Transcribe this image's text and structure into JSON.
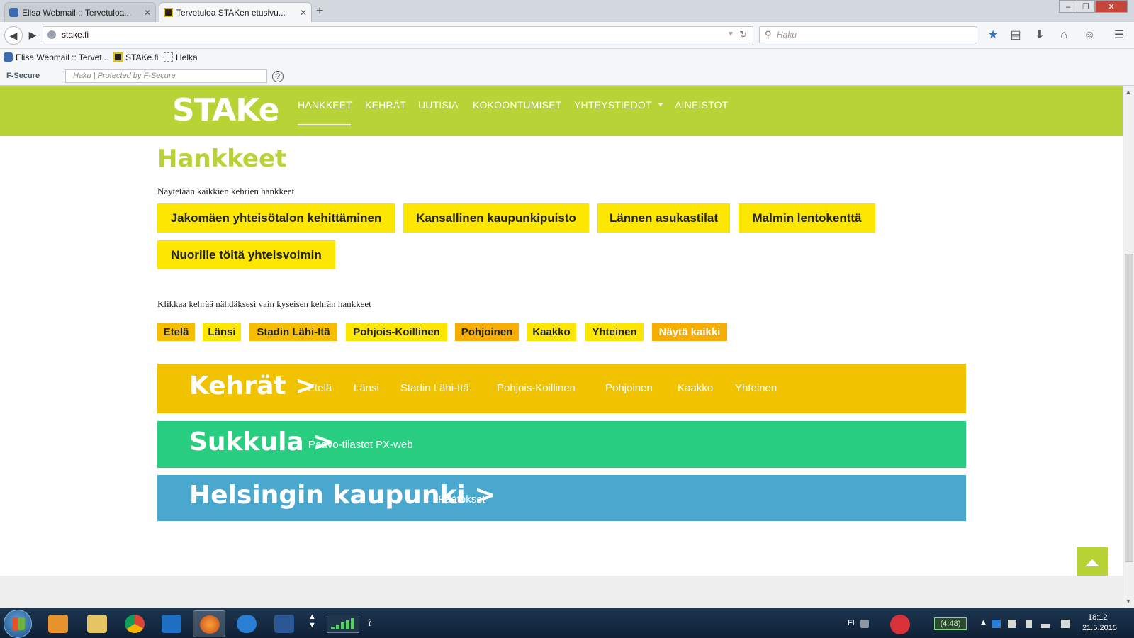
{
  "browser": {
    "tabs": [
      {
        "label": "Elisa Webmail :: Tervetuloa...",
        "active": false
      },
      {
        "label": "Tervetuloa STAKen etusivu...",
        "active": true
      }
    ],
    "new_tab": "+",
    "url": "stake.fi",
    "search_placeholder": "Haku",
    "bookmarks": [
      "Elisa Webmail :: Tervet...",
      "STAKe.fi",
      "Helka"
    ],
    "fsecure": {
      "logo": "F-Secure",
      "placeholder": "Haku | Protected by F-Secure",
      "help": "?"
    }
  },
  "site": {
    "logo": "STAKe",
    "menu": [
      "HANKKEET",
      "KEHRÄT",
      "UUTISIA",
      "KOKOONTUMISET",
      "YHTEYSTIEDOT",
      "AINEISTOT"
    ],
    "page_title": "Hankkeet",
    "showing_note": "Näytetään kaikkien kehrien hankkeet",
    "projects": [
      "Jakomäen yhteisötalon kehittäminen",
      "Kansallinen kaupunkipuisto",
      "Lännen asukastilat",
      "Malmin lentokenttä",
      "Nuorille töitä yhteisvoimin"
    ],
    "filter_note": "Klikkaa kehrää nähdäksesi vain kyseisen kehrän hankkeet",
    "filters": [
      "Etelä",
      "Länsi",
      "Stadin Lähi-Itä",
      "Pohjois-Koillinen",
      "Pohjoinen",
      "Kaakko",
      "Yhteinen",
      "Näytä kaikki"
    ],
    "bands": {
      "kehrat": {
        "title": "Kehrät >",
        "links": [
          "Etelä",
          "Länsi",
          "Stadin Lähi-Itä",
          "Pohjois-Koillinen",
          "Pohjoinen",
          "Kaakko",
          "Yhteinen"
        ],
        "color": "#f0c200"
      },
      "sukkula": {
        "title": "Sukkula >",
        "link": "Paavo-tilastot PX-web",
        "color": "#28cd80"
      },
      "helsinki": {
        "title": "Helsingin kaupunki >",
        "link": "Päätökset",
        "color": "#4aa8cf"
      }
    },
    "accent_color": "#b7d335",
    "project_color": "#fde700"
  },
  "taskbar": {
    "language": "FI",
    "battery": "(4:48)",
    "time": "18:12",
    "date": "21.5.2015"
  }
}
